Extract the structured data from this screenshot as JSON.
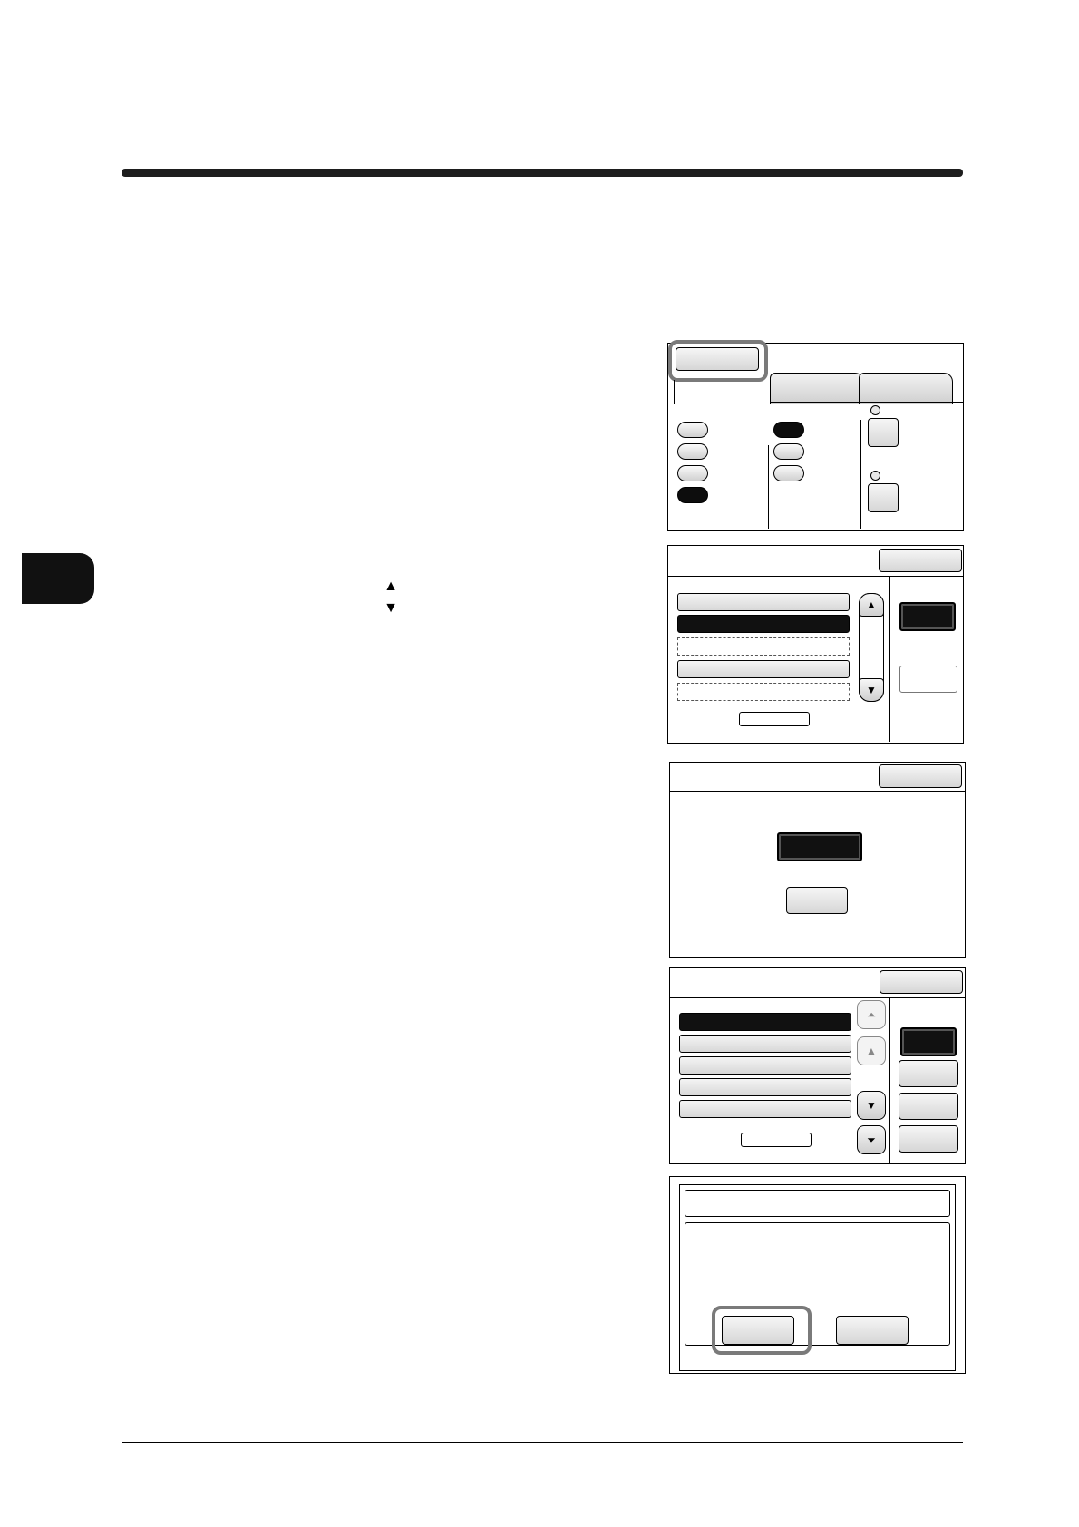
{
  "page": {
    "chapter_marker": "chapter-tab"
  },
  "instruction": {
    "scroll_up_icon": "▲",
    "scroll_down_icon": "▼"
  },
  "screens": {
    "s4": {
      "top_icon": "⏶",
      "up_icon": "▲",
      "down_icon": "▼",
      "bottom_icon": "⏷"
    },
    "s2": {
      "up_icon": "▲",
      "down_icon": "▼"
    }
  },
  "colors": {
    "ink": "#000000",
    "highlight": "#7a7a7a",
    "selected": "#111111"
  }
}
